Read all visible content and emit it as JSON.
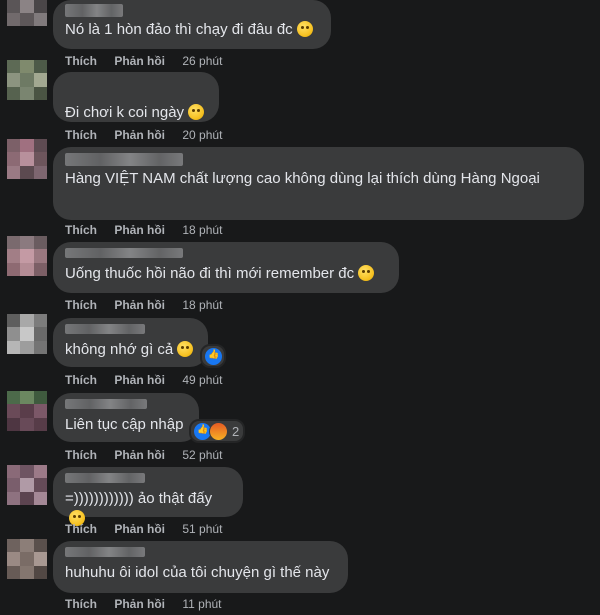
{
  "actions": {
    "like_label": "Thích",
    "reply_label": "Phản hồi"
  },
  "comments": [
    {
      "text": "Nó là 1 hòn đảo thì chạy đi đâu đc",
      "emoji": "sleepy-face-icon",
      "time": "26 phút"
    },
    {
      "text": "Đi chơi k coi ngày",
      "emoji": "grinning-face-icon",
      "time": "20 phút"
    },
    {
      "text": "Hàng VIỆT NAM chất lượng cao không dùng lại thích dùng Hàng Ngoại",
      "time": "18 phút"
    },
    {
      "text": "Uống thuốc hồi não đi thì mới remember đc",
      "emoji": "grinning-face-icon",
      "time": "18 phút"
    },
    {
      "text": "không nhớ gì cả",
      "emoji": "laughing-face-icon",
      "time": "49 phút",
      "reactions": [
        "like"
      ]
    },
    {
      "text": "Liên tục cập nhập",
      "time": "52 phút",
      "reactions": [
        "like",
        "angry"
      ],
      "reaction_count": "2"
    },
    {
      "text": "=)))))))))))) ảo thật đấy",
      "emoji": "tongue-face-icon",
      "time": "51 phút"
    },
    {
      "text": "huhuhu ôi idol của tôi chuyện gì thế này",
      "time": "11 phút"
    }
  ],
  "colors": {
    "background": "#18191a",
    "bubble": "#3a3b3c",
    "text": "#e4e6eb",
    "meta": "#b0b3b8",
    "like_blue": "#1877f2"
  }
}
